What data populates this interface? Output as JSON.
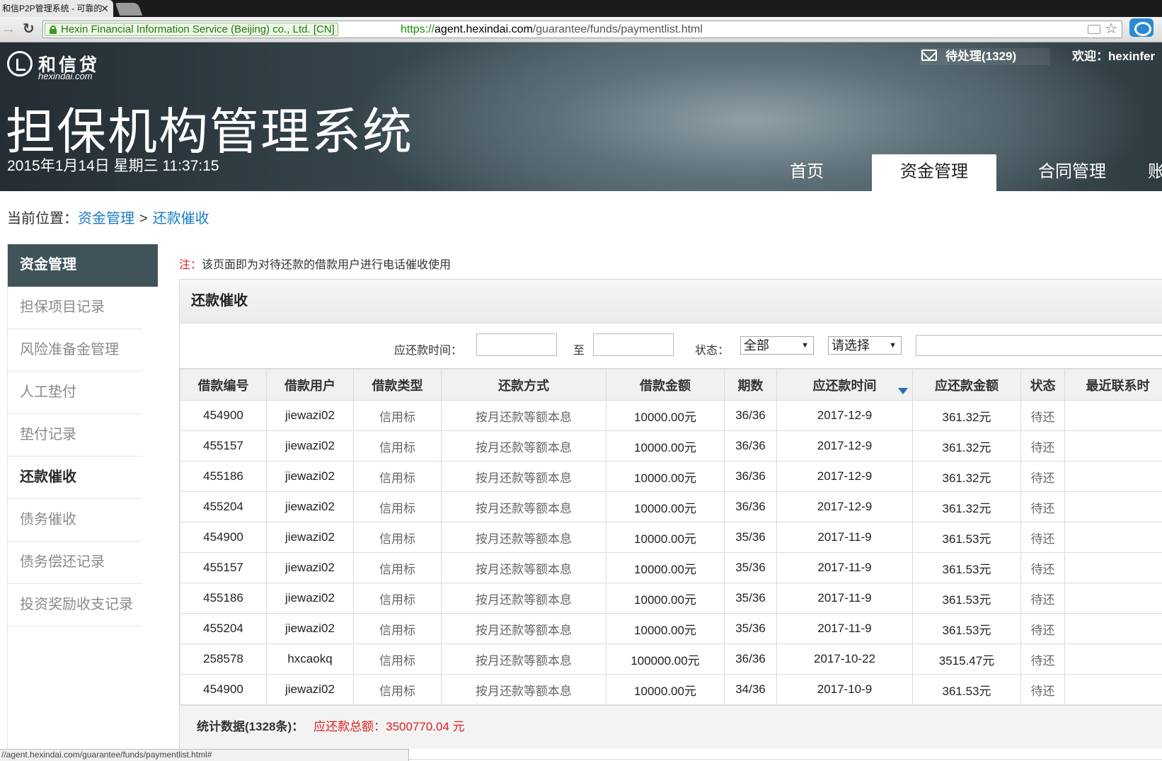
{
  "browser": {
    "tab_title": "和信P2P管理系统 - 可靠的",
    "ev_org": "Hexin Financial Information Service (Beijing) co., Ltd. [CN]",
    "url_scheme": "https://",
    "url_host": "agent.hexindai.com",
    "url_path": "/guarantee/funds/paymentlist.html",
    "status_url": "//agent.hexindai.com/guarantee/funds/paymentlist.html#"
  },
  "header": {
    "logo_text": "和信贷",
    "logo_sub": "hexindai.com",
    "system_title": "担保机构管理系统",
    "datetime": "2015年1月14日 星期三 11:37:15",
    "pending": "待处理(1329)",
    "welcome": "欢迎：hexinfer",
    "nav": [
      {
        "label": "首页"
      },
      {
        "label": "资金管理"
      },
      {
        "label": "合同管理"
      },
      {
        "label": "账"
      }
    ]
  },
  "breadcrumb": {
    "prefix": "当前位置：",
    "level1": "资金管理",
    "separator": ">",
    "level2": "还款催收"
  },
  "sidebar": {
    "title": "资金管理",
    "items": [
      {
        "label": "担保项目记录"
      },
      {
        "label": "风险准备金管理"
      },
      {
        "label": "人工垫付"
      },
      {
        "label": "垫付记录"
      },
      {
        "label": "还款催收"
      },
      {
        "label": "债务催收"
      },
      {
        "label": "债务偿还记录"
      },
      {
        "label": "投资奖励收支记录"
      }
    ]
  },
  "main": {
    "note_prefix": "注：",
    "note_text": "该页面即为对待还款的借款用户进行电话催收使用",
    "panel_title": "还款催收",
    "filters": {
      "due_time_label": "应还款时间：",
      "to_label": "至",
      "status_label": "状态：",
      "status_value": "全部",
      "type_value": "请选择"
    },
    "columns": [
      "借款编号",
      "借款用户",
      "借款类型",
      "还款方式",
      "借款金额",
      "期数",
      "应还款时间",
      "应还款金额",
      "状态",
      "最近联系时"
    ],
    "rows": [
      [
        "454900",
        "jiewazi02",
        "信用标",
        "按月还款等额本息",
        "10000.00元",
        "36/36",
        "2017-12-9",
        "361.32元",
        "待还",
        ""
      ],
      [
        "455157",
        "jiewazi02",
        "信用标",
        "按月还款等额本息",
        "10000.00元",
        "36/36",
        "2017-12-9",
        "361.32元",
        "待还",
        ""
      ],
      [
        "455186",
        "jiewazi02",
        "信用标",
        "按月还款等额本息",
        "10000.00元",
        "36/36",
        "2017-12-9",
        "361.32元",
        "待还",
        ""
      ],
      [
        "455204",
        "jiewazi02",
        "信用标",
        "按月还款等额本息",
        "10000.00元",
        "36/36",
        "2017-12-9",
        "361.32元",
        "待还",
        ""
      ],
      [
        "454900",
        "jiewazi02",
        "信用标",
        "按月还款等额本息",
        "10000.00元",
        "35/36",
        "2017-11-9",
        "361.53元",
        "待还",
        ""
      ],
      [
        "455157",
        "jiewazi02",
        "信用标",
        "按月还款等额本息",
        "10000.00元",
        "35/36",
        "2017-11-9",
        "361.53元",
        "待还",
        ""
      ],
      [
        "455186",
        "jiewazi02",
        "信用标",
        "按月还款等额本息",
        "10000.00元",
        "35/36",
        "2017-11-9",
        "361.53元",
        "待还",
        ""
      ],
      [
        "455204",
        "jiewazi02",
        "信用标",
        "按月还款等额本息",
        "10000.00元",
        "35/36",
        "2017-11-9",
        "361.53元",
        "待还",
        ""
      ],
      [
        "258578",
        "hxcaokq",
        "信用标",
        "按月还款等额本息",
        "100000.00元",
        "36/36",
        "2017-10-22",
        "3515.47元",
        "待还",
        ""
      ],
      [
        "454900",
        "jiewazi02",
        "信用标",
        "按月还款等额本息",
        "10000.00元",
        "34/36",
        "2017-10-9",
        "361.53元",
        "待还",
        ""
      ]
    ],
    "summary_count": "统计数据(1328条)：",
    "summary_total": "应还款总额：3500770.04 元"
  }
}
